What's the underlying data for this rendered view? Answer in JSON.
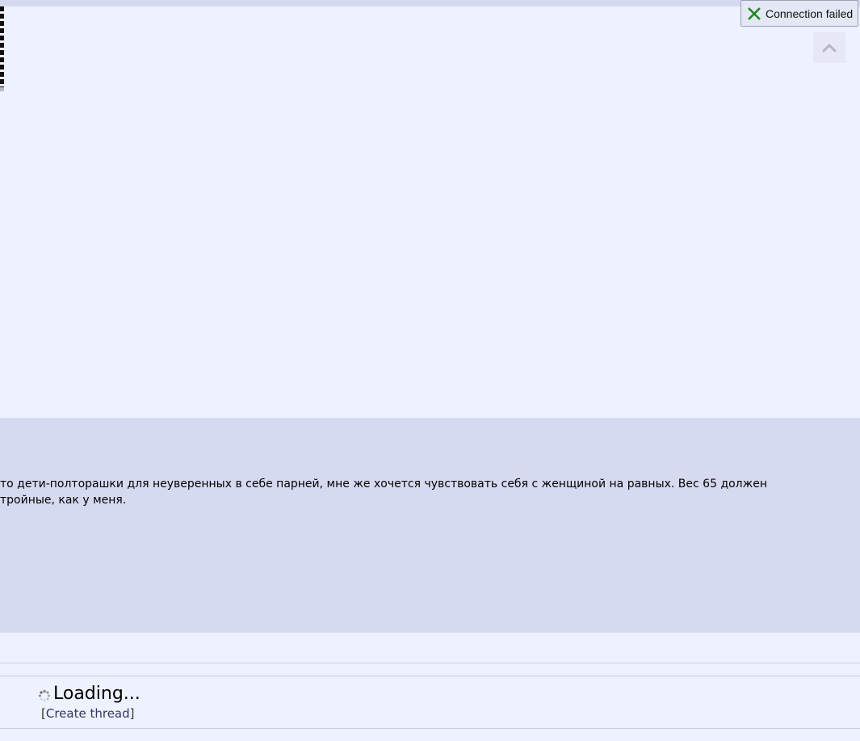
{
  "status": {
    "message": "Connection failed",
    "icon": "close-icon",
    "icon_color": "#1e8a1e"
  },
  "scroll_top": {
    "icon": "chevron-up-icon"
  },
  "post": {
    "lines": [
      "то дети-полторашки для неуверенных в себе парней, мне же хочется чувствовать себя с женщиной на равных. Вес 65 должен",
      "тройные, как у меня."
    ]
  },
  "footer": {
    "loading_label": "Loading...",
    "create_thread_open": "[",
    "create_thread_label": "Create thread",
    "create_thread_close": "]"
  },
  "colors": {
    "page_background": "#eef2ff",
    "post_background": "#d6daf0"
  }
}
